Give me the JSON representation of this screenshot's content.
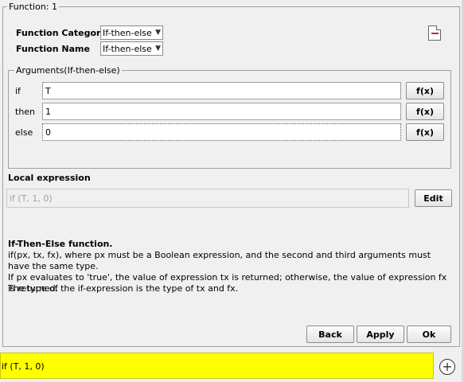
{
  "panel": {
    "title": "Function: 1"
  },
  "function_category": {
    "label": "Function Category",
    "value": "If-then-else"
  },
  "function_name": {
    "label": "Function Name",
    "value": "If-then-else"
  },
  "arguments": {
    "title": "Arguments(If-then-else)",
    "rows": [
      {
        "label": "if",
        "value": "T",
        "button": "f(x)"
      },
      {
        "label": "then",
        "value": "1",
        "button": "f(x)"
      },
      {
        "label": "else",
        "value": "0",
        "button": "f(x)"
      }
    ]
  },
  "local_expression": {
    "label": "Local expression",
    "value": "if (T, 1, 0)",
    "edit_button": "Edit"
  },
  "description": {
    "title": "If-Then-Else function.",
    "line1": "if(px, tx, fx), where px must be a Boolean expression, and the second and third arguments must have the same type.",
    "line2": "If px evaluates to 'true', the value of expression tx is returned; otherwise, the value of expression fx is returned.",
    "line3": "The type of the if-expression is the type of tx and fx."
  },
  "buttons": {
    "back": "Back",
    "apply": "Apply",
    "ok": "Ok"
  },
  "bottom_bar": {
    "expression": "if (T, 1, 0)",
    "highlight_color": "#ffff00"
  }
}
